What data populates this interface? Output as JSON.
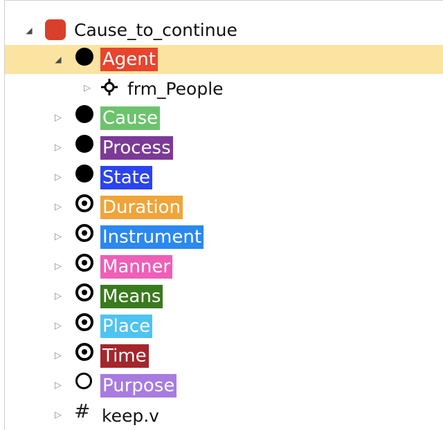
{
  "tree": {
    "frame": {
      "name": "Cause_to_continue",
      "expanded": true,
      "icon": "frame-red-square-icon"
    },
    "nodes": [
      {
        "label": "Agent",
        "type": "core",
        "color": "#e8442e",
        "expanded": true,
        "selected": true,
        "child": {
          "label": "frm_People",
          "icon": "frame-relation-icon"
        }
      },
      {
        "label": "Cause",
        "type": "core",
        "color": "#6cc36c"
      },
      {
        "label": "Process",
        "type": "core",
        "color": "#7b3a96"
      },
      {
        "label": "State",
        "type": "core",
        "color": "#2b44f0"
      },
      {
        "label": "Duration",
        "type": "peripheral",
        "color": "#f0a43a"
      },
      {
        "label": "Instrument",
        "type": "peripheral",
        "color": "#2b88f0"
      },
      {
        "label": "Manner",
        "type": "peripheral",
        "color": "#ee5fb8"
      },
      {
        "label": "Means",
        "type": "peripheral",
        "color": "#3a7a1e"
      },
      {
        "label": "Place",
        "type": "peripheral",
        "color": "#4fc3f2"
      },
      {
        "label": "Time",
        "type": "peripheral",
        "color": "#a3262b"
      },
      {
        "label": "Purpose",
        "type": "extra-thematic",
        "color": "#a77be0"
      }
    ],
    "lu": {
      "label": "keep.v",
      "icon": "hash-icon"
    }
  }
}
